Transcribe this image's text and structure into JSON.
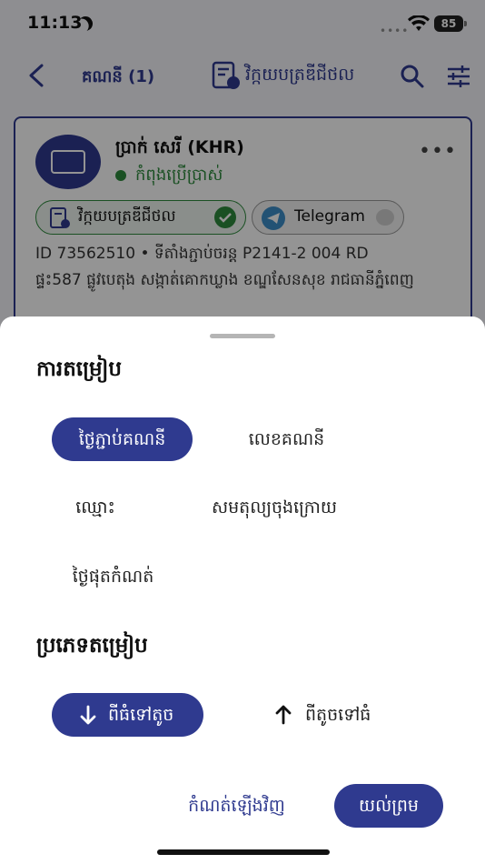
{
  "status_bar": {
    "time": "11:13",
    "battery": "85"
  },
  "nav": {
    "title": "គណនី (1)",
    "doc_label": "វិក្កយបត្រឌីជីថល"
  },
  "account_card": {
    "name": "ប្រាក់ សេរី  (KHR)",
    "status": "កំពុងប្រើប្រាស់",
    "chips": {
      "invoice": "វិក្កយបត្រឌីជីថល",
      "telegram": "Telegram"
    },
    "id_line": "ID  73562510  •  ទីតាំងភ្ជាប់ចរន្ត  P2141-2 004 RD",
    "address": "ផ្ទះ587 ផ្លូវបេតុង  សង្កាត់គោកឃ្លាង ខណ្ឌសែនសុខ រាជធានីភ្នំពេញ"
  },
  "sheet": {
    "sort_title": "ការតម្រៀប",
    "sort_options": {
      "date": "ថ្ងៃភ្ជាប់គណនី",
      "number": "លេខគណនី",
      "name": "ឈ្មោះ",
      "balance": "សមតុល្យចុងក្រោយ",
      "expiry": "ថ្ងៃផុតកំណត់"
    },
    "order_title": "ប្រភេទតម្រៀប",
    "order_options": {
      "desc": "ពីធំទៅតូច",
      "asc": "ពីតូចទៅធំ"
    },
    "reset_label": "កំណត់ឡើងវិញ",
    "apply_label": "យល់ព្រម"
  },
  "colors": {
    "accent": "#2f3a8f",
    "active": "#2e8b3d"
  }
}
